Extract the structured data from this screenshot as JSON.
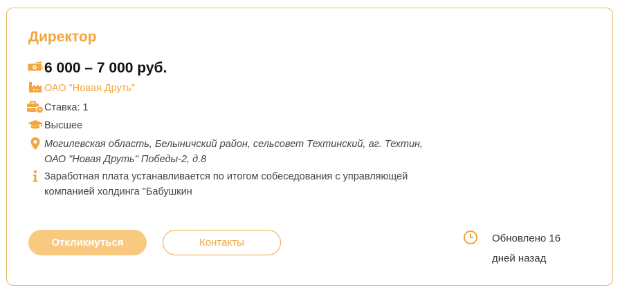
{
  "vacancy": {
    "title": "Директор",
    "salary": "6 000 – 7 000 руб.",
    "company": "ОАО \"Новая Друть\"",
    "rate": "Ставка: 1",
    "education": "Высшее",
    "address_lines": [
      "Могилевская область, Белыничский район, сельсовет Техтинский, аг. Техтин,",
      "ОАО \"Новая Друть\" Победы-2, д.8"
    ],
    "note_lines": [
      "Заработная плата устанавливается по итогом собеседования с управляющей",
      "компанией холдинга \"Бабушкин"
    ]
  },
  "actions": {
    "apply_label": "Откликнуться",
    "contacts_label": "Контакты"
  },
  "updated": {
    "lines": [
      "Обновлено 16",
      "дней назад"
    ]
  },
  "icons": {
    "salary": "money-icon",
    "company": "factory-icon",
    "rate": "briefcase-clock-icon",
    "education": "graduation-cap-icon",
    "address": "map-pin-icon",
    "note": "info-icon",
    "updated": "clock-icon"
  },
  "colors": {
    "accent": "#f2a63b",
    "apply_button_bg": "#f9c97f",
    "card_border": "#e8b66b"
  }
}
